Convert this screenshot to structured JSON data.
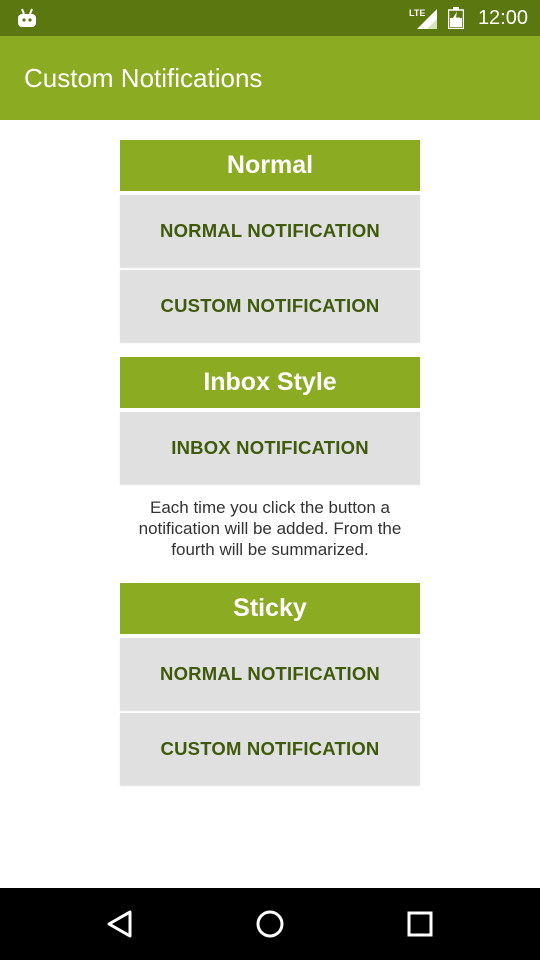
{
  "status_bar": {
    "time": "12:00",
    "network_label": "LTE",
    "icons": [
      "android-icon",
      "lte-signal-icon",
      "battery-icon"
    ]
  },
  "app_bar": {
    "title": "Custom Notifications"
  },
  "sections": [
    {
      "header": "Normal",
      "buttons": [
        "NORMAL NOTIFICATION",
        "CUSTOM NOTIFICATION"
      ]
    },
    {
      "header": "Inbox Style",
      "buttons": [
        "INBOX NOTIFICATION"
      ],
      "note": "Each time you click the button a notification will be added. From the fourth will be summarized."
    },
    {
      "header": "Sticky",
      "buttons": [
        "NORMAL NOTIFICATION",
        "CUSTOM NOTIFICATION"
      ]
    }
  ],
  "nav_bar": {
    "icons": [
      "back-icon",
      "home-icon",
      "recents-icon"
    ]
  },
  "colors": {
    "status_bar": "#5a7710",
    "primary": "#8aab22",
    "button_bg": "#e0e0e0",
    "button_text": "#3f5a0a",
    "nav_bar": "#000000"
  }
}
